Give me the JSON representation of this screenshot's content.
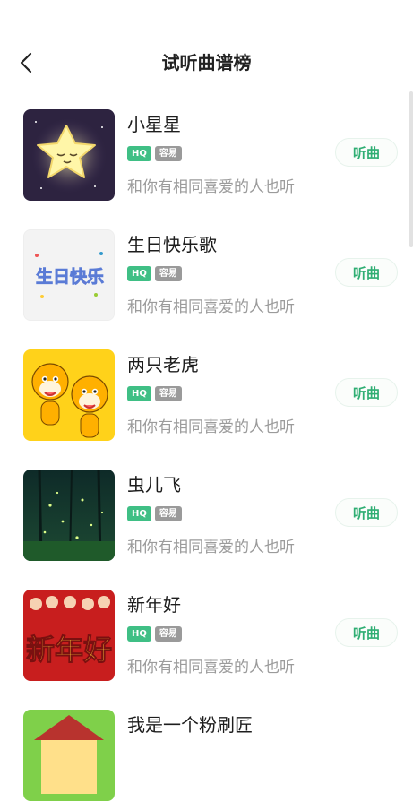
{
  "header": {
    "title": "试听曲谱榜"
  },
  "colors": {
    "accent": "#2fae73",
    "hq_tag": "#3fbf85",
    "level_tag": "#9a9a9a",
    "subtitle": "#9b9b9b"
  },
  "songs": [
    {
      "title": "小星星",
      "hq": "HQ",
      "level": "容易",
      "subtitle": "和你有相同喜爱的人也听",
      "action": "听曲"
    },
    {
      "title": "生日快乐歌",
      "hq": "HQ",
      "level": "容易",
      "subtitle": "和你有相同喜爱的人也听",
      "action": "听曲",
      "cover_text": "生日快乐"
    },
    {
      "title": "两只老虎",
      "hq": "HQ",
      "level": "容易",
      "subtitle": "和你有相同喜爱的人也听",
      "action": "听曲"
    },
    {
      "title": "虫儿飞",
      "hq": "HQ",
      "level": "容易",
      "subtitle": "和你有相同喜爱的人也听",
      "action": "听曲"
    },
    {
      "title": "新年好",
      "hq": "HQ",
      "level": "容易",
      "subtitle": "和你有相同喜爱的人也听",
      "action": "听曲",
      "cover_text": "新年好"
    },
    {
      "title": "我是一个粉刷匠"
    }
  ]
}
